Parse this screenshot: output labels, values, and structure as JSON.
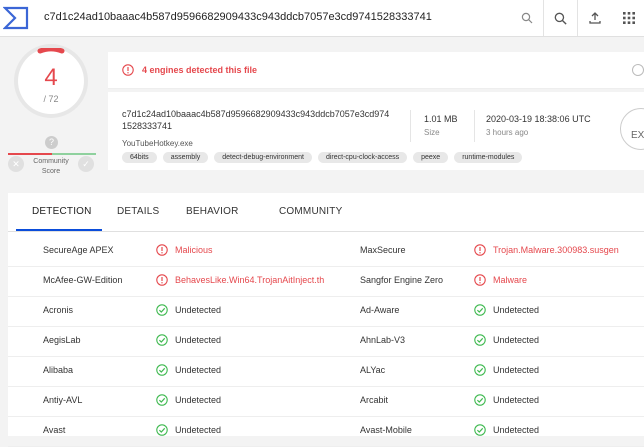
{
  "search": {
    "query": "c7d1c24ad10baaac4b587d9596682909433c943ddcb7057e3cd9741528333741"
  },
  "score": {
    "detected": "4",
    "total": "/ 72",
    "community_label": "Community Score",
    "community_value": "?"
  },
  "banner": {
    "text": "4 engines detected this file"
  },
  "file": {
    "hash": "c7d1c24ad10baaac4b587d9596682909433c943ddcb7057e3cd9741528333741",
    "name": "YouTubeHotkey.exe",
    "size_value": "1.01 MB",
    "size_label": "Size",
    "date_value": "2020-03-19 18:38:06 UTC",
    "date_label": "3 hours ago",
    "type_badge": "EX",
    "tags": [
      "64bits",
      "assembly",
      "detect-debug-environment",
      "direct-cpu-clock-access",
      "peexe",
      "runtime-modules"
    ]
  },
  "tabs": [
    "DETECTION",
    "DETAILS",
    "BEHAVIOR",
    "COMMUNITY"
  ],
  "active_tab": "DETECTION",
  "detections": [
    {
      "left": {
        "engine": "SecureAge APEX",
        "result": "Malicious",
        "status": "malicious"
      },
      "right": {
        "engine": "MaxSecure",
        "result": "Trojan.Malware.300983.susgen",
        "status": "malicious"
      }
    },
    {
      "left": {
        "engine": "McAfee-GW-Edition",
        "result": "BehavesLike.Win64.TrojanAitInject.th",
        "status": "malicious"
      },
      "right": {
        "engine": "Sangfor Engine Zero",
        "result": "Malware",
        "status": "malicious"
      }
    },
    {
      "left": {
        "engine": "Acronis",
        "result": "Undetected",
        "status": "clean"
      },
      "right": {
        "engine": "Ad-Aware",
        "result": "Undetected",
        "status": "clean"
      }
    },
    {
      "left": {
        "engine": "AegisLab",
        "result": "Undetected",
        "status": "clean"
      },
      "right": {
        "engine": "AhnLab-V3",
        "result": "Undetected",
        "status": "clean"
      }
    },
    {
      "left": {
        "engine": "Alibaba",
        "result": "Undetected",
        "status": "clean"
      },
      "right": {
        "engine": "ALYac",
        "result": "Undetected",
        "status": "clean"
      }
    },
    {
      "left": {
        "engine": "Antiy-AVL",
        "result": "Undetected",
        "status": "clean"
      },
      "right": {
        "engine": "Arcabit",
        "result": "Undetected",
        "status": "clean"
      }
    },
    {
      "left": {
        "engine": "Avast",
        "result": "Undetected",
        "status": "clean"
      },
      "right": {
        "engine": "Avast-Mobile",
        "result": "Undetected",
        "status": "clean"
      }
    }
  ],
  "colors": {
    "malicious": "#e5484d",
    "clean": "#3fb950",
    "accent": "#0b4dda"
  },
  "icons": [
    "virustotal-logo",
    "search-icon",
    "upload-icon",
    "apps-grid-icon",
    "alert-circle-icon",
    "check-circle-icon"
  ]
}
